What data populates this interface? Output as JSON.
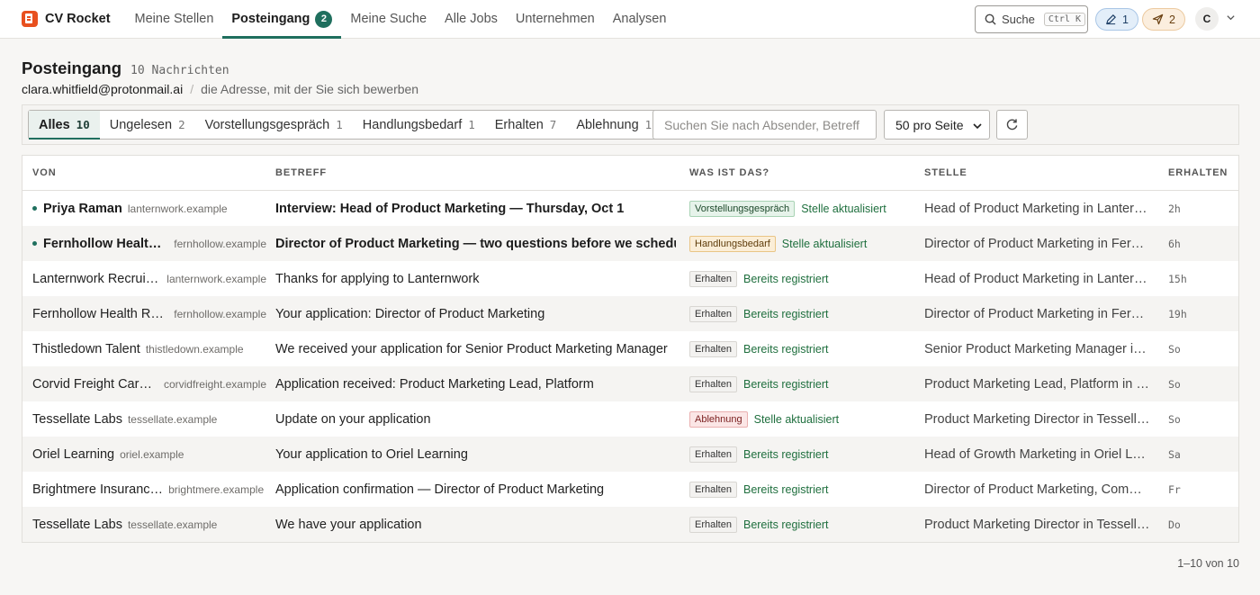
{
  "app": {
    "brand": "CV Rocket"
  },
  "nav": {
    "links": [
      "Meine Stellen",
      "Posteingang",
      "Meine Suche",
      "Alle Jobs",
      "Unternehmen",
      "Analysen"
    ],
    "inbox_badge": "2",
    "search_label": "Suche",
    "search_shortcut": "Ctrl K",
    "edit_count": "1",
    "send_count": "2",
    "avatar_initial": "C"
  },
  "header": {
    "title": "Posteingang",
    "count": "10 Nachrichten",
    "email": "clara.whitfield@protonmail.ai",
    "hint": "die Adresse, mit der Sie sich bewerben"
  },
  "filters": {
    "tabs": [
      {
        "label": "Alles",
        "count": "10"
      },
      {
        "label": "Ungelesen",
        "count": "2"
      },
      {
        "label": "Vorstellungsgespräch",
        "count": "1"
      },
      {
        "label": "Handlungsbedarf",
        "count": "1"
      },
      {
        "label": "Erhalten",
        "count": "7"
      },
      {
        "label": "Ablehnung",
        "count": "1"
      }
    ],
    "search_placeholder": "Suchen Sie nach Absender, Betreff",
    "page_size": "50 pro Seite"
  },
  "table": {
    "columns": [
      "VON",
      "BETREFF",
      "WAS IST DAS?",
      "STELLE",
      "ERHALTEN"
    ],
    "rows": [
      {
        "sender": "Priya Raman",
        "domain": "lanternwork.example",
        "subject": "Interview: Head of Product Marketing — Thursday, Oct 1",
        "badge": "Vorstellungsgespräch",
        "status": "Stelle aktualisiert",
        "job": "Head of Product Marketing in Lanternwork",
        "time": "2h"
      },
      {
        "sender": "Fernhollow Health …",
        "domain": "fernhollow.example",
        "subject": "Director of Product Marketing — two questions before we schedule",
        "badge": "Handlungsbedarf",
        "status": "Stelle aktualisiert",
        "job": "Director of Product Marketing in Fernhollow Health",
        "time": "6h"
      },
      {
        "sender": "Lanternwork Recruit…",
        "domain": "lanternwork.example",
        "subject": "Thanks for applying to Lanternwork",
        "badge": "Erhalten",
        "status": "Bereits registriert",
        "job": "Head of Product Marketing in Lanternwork",
        "time": "15h"
      },
      {
        "sender": "Fernhollow Health Re…",
        "domain": "fernhollow.example",
        "subject": "Your application: Director of Product Marketing",
        "badge": "Erhalten",
        "status": "Bereits registriert",
        "job": "Director of Product Marketing in Fernhollow Health",
        "time": "19h"
      },
      {
        "sender": "Thistledown Talent",
        "domain": "thistledown.example",
        "subject": "We received your application for Senior Product Marketing Manager",
        "badge": "Erhalten",
        "status": "Bereits registriert",
        "job": "Senior Product Marketing Manager in Thistledown",
        "time": "So"
      },
      {
        "sender": "Corvid Freight Care…",
        "domain": "corvidfreight.example",
        "subject": "Application received: Product Marketing Lead, Platform",
        "badge": "Erhalten",
        "status": "Bereits registriert",
        "job": "Product Marketing Lead, Platform in Corvid Freight",
        "time": "So"
      },
      {
        "sender": "Tessellate Labs",
        "domain": "tessellate.example",
        "subject": "Update on your application",
        "badge": "Ablehnung",
        "status": "Stelle aktualisiert",
        "job": "Product Marketing Director in Tessellate Labs",
        "time": "So"
      },
      {
        "sender": "Oriel Learning",
        "domain": "oriel.example",
        "subject": "Your application to Oriel Learning",
        "badge": "Erhalten",
        "status": "Bereits registriert",
        "job": "Head of Growth Marketing in Oriel Learning",
        "time": "Sa"
      },
      {
        "sender": "Brightmere Insuranc…",
        "domain": "brightmere.example",
        "subject": "Application confirmation — Director of Product Marketing",
        "badge": "Erhalten",
        "status": "Bereits registriert",
        "job": "Director of Product Marketing, Commercial",
        "time": "Fr"
      },
      {
        "sender": "Tessellate Labs",
        "domain": "tessellate.example",
        "subject": "We have your application",
        "badge": "Erhalten",
        "status": "Bereits registriert",
        "job": "Product Marketing Director in Tessellate Labs",
        "time": "Do"
      }
    ]
  },
  "pagination": "1–10 von 10",
  "colors": {
    "accent": "#1f6f5e",
    "brand": "#e8501f"
  }
}
